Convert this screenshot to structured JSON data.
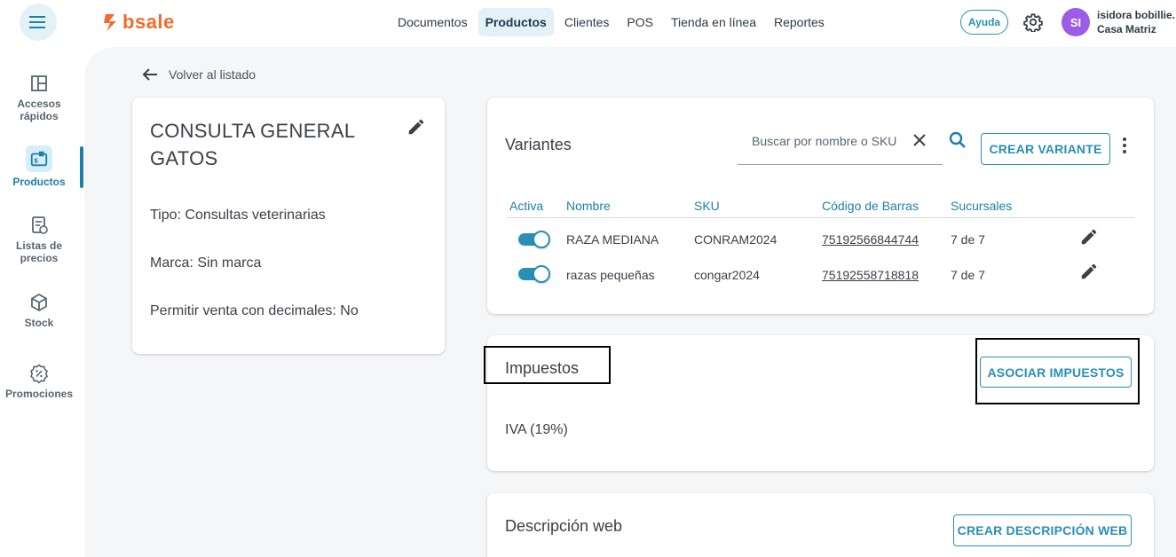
{
  "header": {
    "logo_text": "bsale",
    "nav": [
      "Documentos",
      "Productos",
      "Clientes",
      "POS",
      "Tienda en línea",
      "Reportes"
    ],
    "active_nav": "Productos",
    "help_label": "Ayuda",
    "avatar_initials": "SI",
    "user_name": "isidora bobillie.",
    "user_branch": "Casa Matriz"
  },
  "sidebar": {
    "items": [
      {
        "label": "Accesos rápidos",
        "icon": "layout-icon"
      },
      {
        "label": "Productos",
        "icon": "products-icon",
        "active": true
      },
      {
        "label": "Listas de precios",
        "icon": "price-list-icon"
      },
      {
        "label": "Stock",
        "icon": "box-icon"
      },
      {
        "label": "Promociones",
        "icon": "percent-badge-icon"
      }
    ]
  },
  "back_label": "Volver al listado",
  "product": {
    "title": "CONSULTA GENERAL GATOS",
    "tipo": "Tipo: Consultas veterinarias",
    "marca": "Marca: Sin marca",
    "decimales": "Permitir venta con decimales: No"
  },
  "variants": {
    "title": "Variantes",
    "search_placeholder": "Buscar por nombre o SKU",
    "create_label": "CREAR VARIANTE",
    "columns": [
      "Activa",
      "Nombre",
      "SKU",
      "Código de Barras",
      "Sucursales"
    ],
    "rows": [
      {
        "active": true,
        "name": "RAZA MEDIANA",
        "sku": "CONRAM2024",
        "barcode": "75192566844744",
        "branches": "7 de 7"
      },
      {
        "active": true,
        "name": "razas pequeñas",
        "sku": "congar2024",
        "barcode": "75192558718818",
        "branches": "7 de 7"
      }
    ]
  },
  "taxes": {
    "title": "Impuestos",
    "button_label": "ASOCIAR IMPUESTOS",
    "value": "IVA (19%)"
  },
  "web": {
    "title": "Descripción web",
    "button_label": "CREAR DESCRIPCIÓN WEB"
  },
  "colors": {
    "accent": "#2a8fb5",
    "brand": "#f26b2a",
    "avatar": "#9b5de5"
  }
}
